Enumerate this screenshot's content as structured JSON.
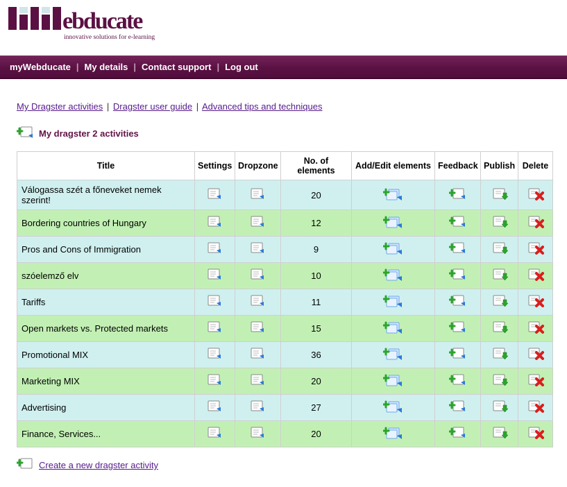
{
  "brand": {
    "name": "Webducate",
    "tagline": "innovative solutions for e-learning"
  },
  "navbar": {
    "items": [
      {
        "label": "myWebducate"
      },
      {
        "label": "My details"
      },
      {
        "label": "Contact support"
      },
      {
        "label": "Log out"
      }
    ]
  },
  "top_links": [
    {
      "label": "My Dragster activities"
    },
    {
      "label": "Dragster user guide"
    },
    {
      "label": "Advanced tips and techniques"
    }
  ],
  "section_title": "My dragster 2 activities",
  "columns": [
    "Title",
    "Settings",
    "Dropzone",
    "No. of elements",
    "Add/Edit elements",
    "Feedback",
    "Publish",
    "Delete"
  ],
  "rows": [
    {
      "title": "Válogassa szét a főneveket nemek szerint!",
      "elements": 20
    },
    {
      "title": "Bordering countries of Hungary",
      "elements": 12
    },
    {
      "title": "Pros and Cons of Immigration",
      "elements": 9
    },
    {
      "title": "szóelemző elv",
      "elements": 10
    },
    {
      "title": "Tariffs",
      "elements": 11
    },
    {
      "title": "Open markets vs. Protected markets",
      "elements": 15
    },
    {
      "title": "Promotional MIX",
      "elements": 36
    },
    {
      "title": "Marketing MIX",
      "elements": 20
    },
    {
      "title": "Advertising",
      "elements": 27
    },
    {
      "title": "Finance, Services...",
      "elements": 20
    }
  ],
  "create_label": "Create a new dragster activity"
}
